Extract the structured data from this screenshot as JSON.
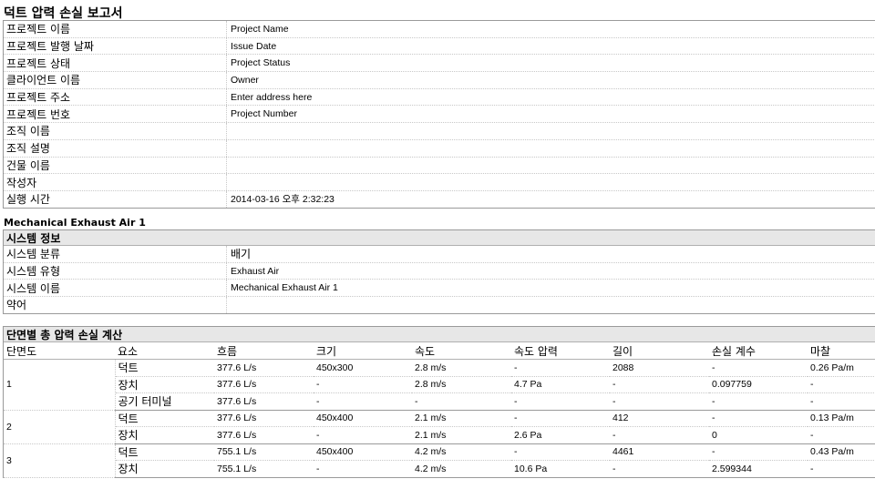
{
  "report_title": "덕트 압력 손실 보고서",
  "project_info": [
    {
      "label": "프로젝트 이름",
      "value": "Project Name"
    },
    {
      "label": "프로젝트 발행 날짜",
      "value": "Issue Date"
    },
    {
      "label": "프로젝트 상태",
      "value": "Project Status"
    },
    {
      "label": "클라이언트 이름",
      "value": "Owner"
    },
    {
      "label": "프로젝트 주소",
      "value": "Enter address here"
    },
    {
      "label": "프로젝트 번호",
      "value": "Project Number"
    },
    {
      "label": "조직 이름",
      "value": ""
    },
    {
      "label": "조직 설명",
      "value": ""
    },
    {
      "label": "건물 이름",
      "value": ""
    },
    {
      "label": "작성자",
      "value": ""
    },
    {
      "label": "실행 시간",
      "value": "2014-03-16 오후 2:32:23"
    }
  ],
  "system_heading": "Mechanical Exhaust Air 1",
  "system_info": {
    "title": "시스템 정보",
    "rows": [
      {
        "label": "시스템 분류",
        "value": "배기"
      },
      {
        "label": "시스템 유형",
        "value": "Exhaust Air"
      },
      {
        "label": "시스템 이름",
        "value": "Mechanical Exhaust Air 1"
      },
      {
        "label": "약어",
        "value": ""
      }
    ]
  },
  "pressure_loss": {
    "title": "단면별 총 압력 손실 계산",
    "columns": [
      "단면도",
      "요소",
      "흐름",
      "크기",
      "속도",
      "속도 압력",
      "길이",
      "손실 계수",
      "마찰"
    ],
    "sections": [
      {
        "section": "1",
        "rows": [
          {
            "element": "덕트",
            "flow": "377.6 L/s",
            "size": "450x300",
            "velocity": "2.8 m/s",
            "vp": "-",
            "length": "2088",
            "coef": "-",
            "friction": "0.26 Pa/m"
          },
          {
            "element": "장치",
            "flow": "377.6 L/s",
            "size": "-",
            "velocity": "2.8 m/s",
            "vp": "4.7 Pa",
            "length": "-",
            "coef": "0.097759",
            "friction": "-"
          },
          {
            "element": "공기 터미널",
            "flow": "377.6 L/s",
            "size": "-",
            "velocity": "-",
            "vp": "-",
            "length": "-",
            "coef": "-",
            "friction": "-"
          }
        ]
      },
      {
        "section": "2",
        "rows": [
          {
            "element": "덕트",
            "flow": "377.6 L/s",
            "size": "450x400",
            "velocity": "2.1 m/s",
            "vp": "-",
            "length": "412",
            "coef": "-",
            "friction": "0.13 Pa/m"
          },
          {
            "element": "장치",
            "flow": "377.6 L/s",
            "size": "-",
            "velocity": "2.1 m/s",
            "vp": "2.6 Pa",
            "length": "-",
            "coef": "0",
            "friction": "-"
          }
        ]
      },
      {
        "section": "3",
        "rows": [
          {
            "element": "덕트",
            "flow": "755.1 L/s",
            "size": "450x400",
            "velocity": "4.2 m/s",
            "vp": "-",
            "length": "4461",
            "coef": "-",
            "friction": "0.43 Pa/m"
          },
          {
            "element": "장치",
            "flow": "755.1 L/s",
            "size": "-",
            "velocity": "4.2 m/s",
            "vp": "10.6 Pa",
            "length": "-",
            "coef": "2.599344",
            "friction": "-"
          }
        ]
      }
    ]
  }
}
